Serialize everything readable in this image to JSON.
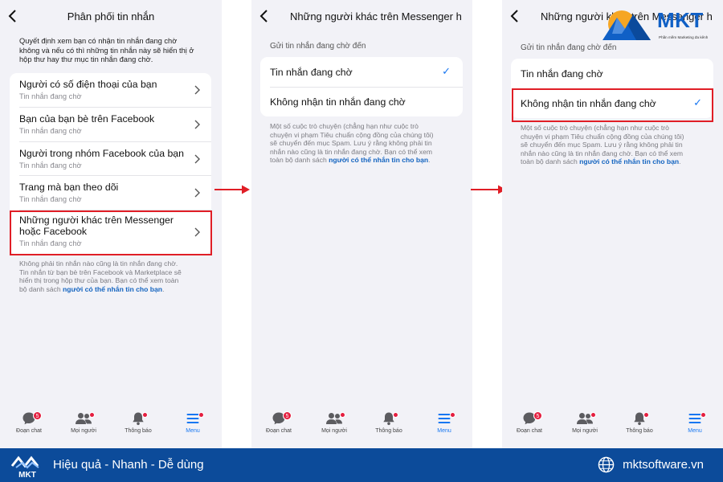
{
  "panel1": {
    "title": "Phân phối tin nhắn",
    "description": [
      "Quyết định xem bạn có nhận tin nhắn đang chờ",
      "không và nếu có thì những tin nhắn này sẽ hiển thị ở",
      "hộp thư hay thư mục tin nhắn đang chờ."
    ],
    "items": [
      {
        "title": "Người có số điện thoại của bạn",
        "subtitle": "Tin nhắn đang chờ"
      },
      {
        "title": "Bạn của bạn bè trên Facebook",
        "subtitle": "Tin nhắn đang chờ"
      },
      {
        "title": "Người trong nhóm Facebook của bạn",
        "subtitle": "Tin nhắn đang chờ"
      },
      {
        "title": "Trang mà bạn theo dõi",
        "subtitle": "Tin nhắn đang chờ"
      },
      {
        "title_line1": "Những người khác trên Messenger",
        "title_line2": "hoặc Facebook",
        "subtitle": "Tin nhắn đang chờ"
      }
    ],
    "note": [
      "Không phải tin nhắn nào cũng là tin nhắn đang chờ.",
      "Tin nhắn từ bạn bè trên Facebook và Marketplace sẽ",
      "hiển thị trong hộp thư của bạn. Bạn có thể xem toàn"
    ],
    "note_last_prefix": "bộ danh sách ",
    "note_link": "người có thể nhắn tin cho bạn",
    "note_last_suffix": "."
  },
  "panel2": {
    "title": "Những người khác trên Messenger h...",
    "section_label": "Gửi tin nhắn đang chờ đến",
    "options": [
      "Tin nhắn đang chờ",
      "Không nhận tin nhắn đang chờ"
    ],
    "selected_index": 0
  },
  "panel3": {
    "title": "Những người khác trên Messenger h...",
    "section_label": "Gửi tin nhắn đang chờ đến",
    "options": [
      "Tin nhắn đang chờ",
      "Không nhận tin nhắn đang chờ"
    ],
    "selected_index": 1
  },
  "panel_note": {
    "lines": [
      "Một số cuộc trò chuyện (chẳng hạn như cuộc trò",
      "chuyện vi phạm Tiêu chuẩn cộng đồng của chúng tôi)",
      "sẽ chuyển đến mục Spam. Lưu ý rằng không phải tin",
      "nhắn nào cũng là tin nhắn đang chờ. Bạn có thể xem"
    ],
    "last_prefix": "toàn bộ danh sách ",
    "link": "người có thể nhắn tin cho bạn",
    "last_suffix": "."
  },
  "check_mark": "✓",
  "tabbar": {
    "tabs": [
      {
        "label": "Đoạn chat",
        "icon": "chat-bubble-icon",
        "badge": "5"
      },
      {
        "label": "Mọi người",
        "icon": "people-icon",
        "dot": true
      },
      {
        "label": "Thông báo",
        "icon": "bell-icon",
        "dot": true
      },
      {
        "label": "Menu",
        "icon": "menu-icon",
        "dot": true,
        "active": true
      }
    ]
  },
  "footer": {
    "slogan": "Hiệu quả - Nhanh - Dễ dùng",
    "website": "mktsoftware.vn",
    "logo_text": "MKT"
  },
  "brand": {
    "name": "MKT",
    "tagline": "Phần mềm Marketing đa kênh"
  },
  "colors": {
    "highlight": "#e01e26",
    "accent": "#1877f2",
    "footer_bg": "#0c4b9a",
    "badge": "#e41e3f"
  }
}
